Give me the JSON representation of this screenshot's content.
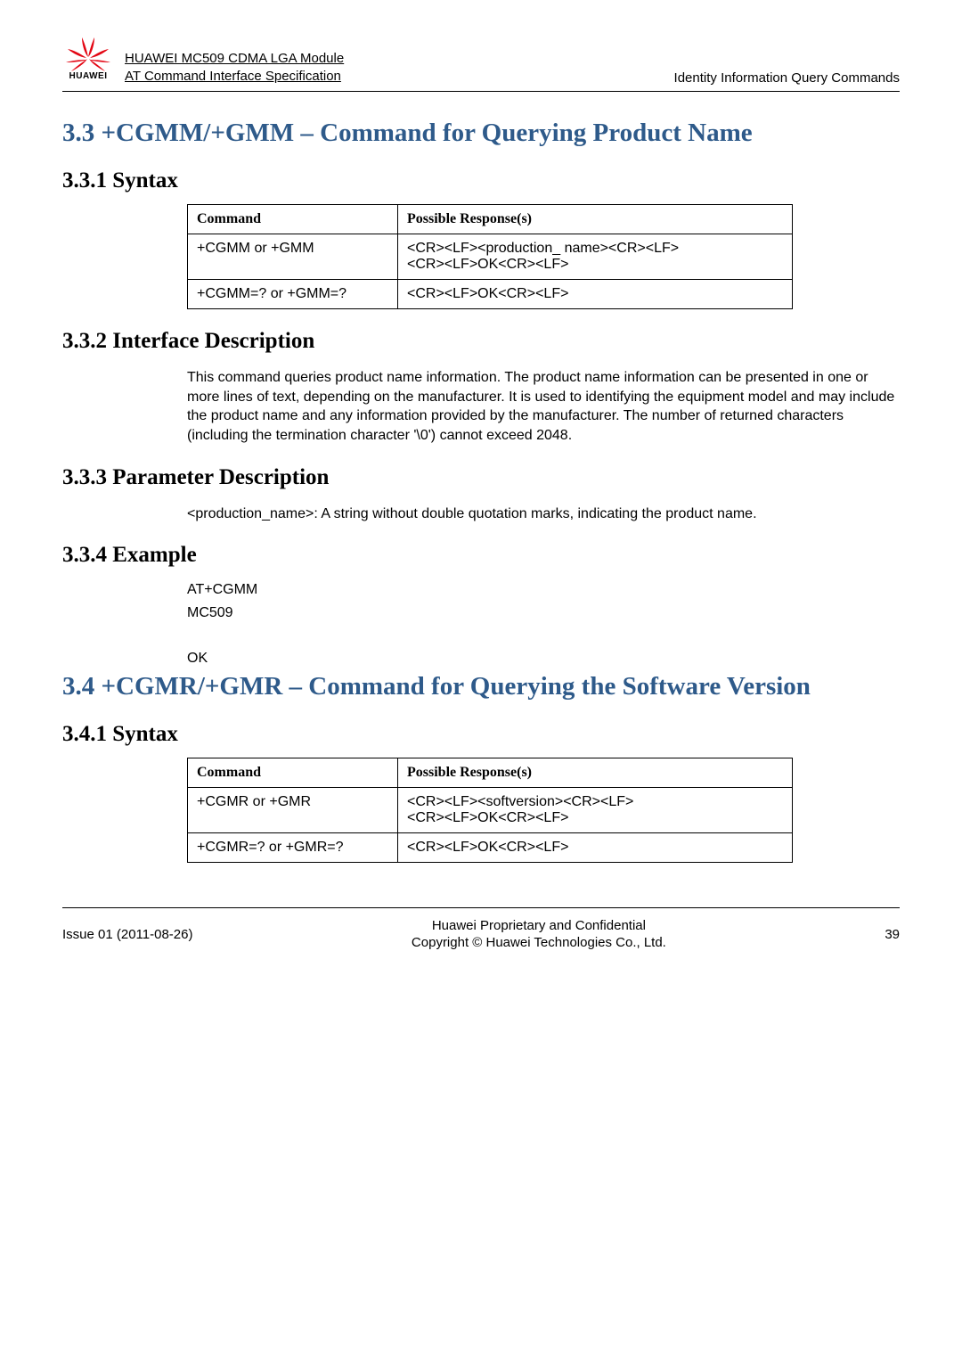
{
  "header": {
    "logo_text": "HUAWEI",
    "title_line1": "HUAWEI MC509 CDMA LGA Module",
    "title_line2": "AT Command Interface Specification",
    "right": "Identity Information Query Commands"
  },
  "sec33": {
    "title": "3.3 +CGMM/+GMM – Command for Querying Product Name",
    "syntax_h": "3.3.1 Syntax",
    "table": {
      "h1": "Command",
      "h2": "Possible Response(s)",
      "r1c1": "+CGMM or +GMM",
      "r1c2a": "<CR><LF><production_ name><CR><LF>",
      "r1c2b": "<CR><LF>OK<CR><LF>",
      "r2c1": "+CGMM=? or +GMM=?",
      "r2c2": "<CR><LF>OK<CR><LF>"
    },
    "ifdesc_h": "3.3.2 Interface Description",
    "ifdesc_body": "This command queries product name information. The product name information can be presented in one or more lines of text, depending on the manufacturer. It is used to identifying the equipment model and may include the product name and any information provided by the manufacturer. The number of returned characters (including the termination character '\\0') cannot exceed 2048.",
    "param_h": "3.3.3 Parameter Description",
    "param_body": "<production_name>: A string without double quotation marks, indicating the product name.",
    "example_h": "3.3.4 Example",
    "example_lines": [
      "AT+CGMM",
      "MC509",
      "",
      "OK"
    ]
  },
  "sec34": {
    "title": "3.4 +CGMR/+GMR – Command for Querying the Software Version",
    "syntax_h": "3.4.1 Syntax",
    "table": {
      "h1": "Command",
      "h2": "Possible Response(s)",
      "r1c1": "+CGMR or +GMR",
      "r1c2a": "<CR><LF><softversion><CR><LF>",
      "r1c2b": "<CR><LF>OK<CR><LF>",
      "r2c1": "+CGMR=? or +GMR=?",
      "r2c2": "<CR><LF>OK<CR><LF>"
    }
  },
  "footer": {
    "left": "Issue 01 (2011-08-26)",
    "center1": "Huawei Proprietary and Confidential",
    "center2": "Copyright © Huawei Technologies Co., Ltd.",
    "right": "39"
  }
}
